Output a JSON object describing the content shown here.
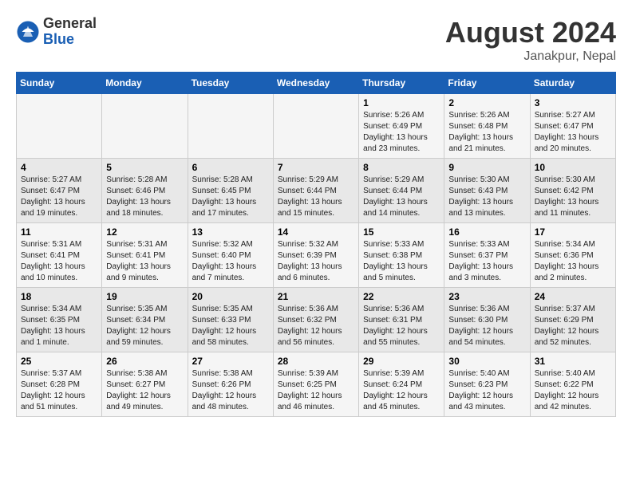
{
  "header": {
    "logo_general": "General",
    "logo_blue": "Blue",
    "title": "August 2024",
    "location": "Janakpur, Nepal"
  },
  "days_of_week": [
    "Sunday",
    "Monday",
    "Tuesday",
    "Wednesday",
    "Thursday",
    "Friday",
    "Saturday"
  ],
  "weeks": [
    [
      {
        "day": "",
        "info": ""
      },
      {
        "day": "",
        "info": ""
      },
      {
        "day": "",
        "info": ""
      },
      {
        "day": "",
        "info": ""
      },
      {
        "day": "1",
        "info": "Sunrise: 5:26 AM\nSunset: 6:49 PM\nDaylight: 13 hours\nand 23 minutes."
      },
      {
        "day": "2",
        "info": "Sunrise: 5:26 AM\nSunset: 6:48 PM\nDaylight: 13 hours\nand 21 minutes."
      },
      {
        "day": "3",
        "info": "Sunrise: 5:27 AM\nSunset: 6:47 PM\nDaylight: 13 hours\nand 20 minutes."
      }
    ],
    [
      {
        "day": "4",
        "info": "Sunrise: 5:27 AM\nSunset: 6:47 PM\nDaylight: 13 hours\nand 19 minutes."
      },
      {
        "day": "5",
        "info": "Sunrise: 5:28 AM\nSunset: 6:46 PM\nDaylight: 13 hours\nand 18 minutes."
      },
      {
        "day": "6",
        "info": "Sunrise: 5:28 AM\nSunset: 6:45 PM\nDaylight: 13 hours\nand 17 minutes."
      },
      {
        "day": "7",
        "info": "Sunrise: 5:29 AM\nSunset: 6:44 PM\nDaylight: 13 hours\nand 15 minutes."
      },
      {
        "day": "8",
        "info": "Sunrise: 5:29 AM\nSunset: 6:44 PM\nDaylight: 13 hours\nand 14 minutes."
      },
      {
        "day": "9",
        "info": "Sunrise: 5:30 AM\nSunset: 6:43 PM\nDaylight: 13 hours\nand 13 minutes."
      },
      {
        "day": "10",
        "info": "Sunrise: 5:30 AM\nSunset: 6:42 PM\nDaylight: 13 hours\nand 11 minutes."
      }
    ],
    [
      {
        "day": "11",
        "info": "Sunrise: 5:31 AM\nSunset: 6:41 PM\nDaylight: 13 hours\nand 10 minutes."
      },
      {
        "day": "12",
        "info": "Sunrise: 5:31 AM\nSunset: 6:41 PM\nDaylight: 13 hours\nand 9 minutes."
      },
      {
        "day": "13",
        "info": "Sunrise: 5:32 AM\nSunset: 6:40 PM\nDaylight: 13 hours\nand 7 minutes."
      },
      {
        "day": "14",
        "info": "Sunrise: 5:32 AM\nSunset: 6:39 PM\nDaylight: 13 hours\nand 6 minutes."
      },
      {
        "day": "15",
        "info": "Sunrise: 5:33 AM\nSunset: 6:38 PM\nDaylight: 13 hours\nand 5 minutes."
      },
      {
        "day": "16",
        "info": "Sunrise: 5:33 AM\nSunset: 6:37 PM\nDaylight: 13 hours\nand 3 minutes."
      },
      {
        "day": "17",
        "info": "Sunrise: 5:34 AM\nSunset: 6:36 PM\nDaylight: 13 hours\nand 2 minutes."
      }
    ],
    [
      {
        "day": "18",
        "info": "Sunrise: 5:34 AM\nSunset: 6:35 PM\nDaylight: 13 hours\nand 1 minute."
      },
      {
        "day": "19",
        "info": "Sunrise: 5:35 AM\nSunset: 6:34 PM\nDaylight: 12 hours\nand 59 minutes."
      },
      {
        "day": "20",
        "info": "Sunrise: 5:35 AM\nSunset: 6:33 PM\nDaylight: 12 hours\nand 58 minutes."
      },
      {
        "day": "21",
        "info": "Sunrise: 5:36 AM\nSunset: 6:32 PM\nDaylight: 12 hours\nand 56 minutes."
      },
      {
        "day": "22",
        "info": "Sunrise: 5:36 AM\nSunset: 6:31 PM\nDaylight: 12 hours\nand 55 minutes."
      },
      {
        "day": "23",
        "info": "Sunrise: 5:36 AM\nSunset: 6:30 PM\nDaylight: 12 hours\nand 54 minutes."
      },
      {
        "day": "24",
        "info": "Sunrise: 5:37 AM\nSunset: 6:29 PM\nDaylight: 12 hours\nand 52 minutes."
      }
    ],
    [
      {
        "day": "25",
        "info": "Sunrise: 5:37 AM\nSunset: 6:28 PM\nDaylight: 12 hours\nand 51 minutes."
      },
      {
        "day": "26",
        "info": "Sunrise: 5:38 AM\nSunset: 6:27 PM\nDaylight: 12 hours\nand 49 minutes."
      },
      {
        "day": "27",
        "info": "Sunrise: 5:38 AM\nSunset: 6:26 PM\nDaylight: 12 hours\nand 48 minutes."
      },
      {
        "day": "28",
        "info": "Sunrise: 5:39 AM\nSunset: 6:25 PM\nDaylight: 12 hours\nand 46 minutes."
      },
      {
        "day": "29",
        "info": "Sunrise: 5:39 AM\nSunset: 6:24 PM\nDaylight: 12 hours\nand 45 minutes."
      },
      {
        "day": "30",
        "info": "Sunrise: 5:40 AM\nSunset: 6:23 PM\nDaylight: 12 hours\nand 43 minutes."
      },
      {
        "day": "31",
        "info": "Sunrise: 5:40 AM\nSunset: 6:22 PM\nDaylight: 12 hours\nand 42 minutes."
      }
    ]
  ]
}
